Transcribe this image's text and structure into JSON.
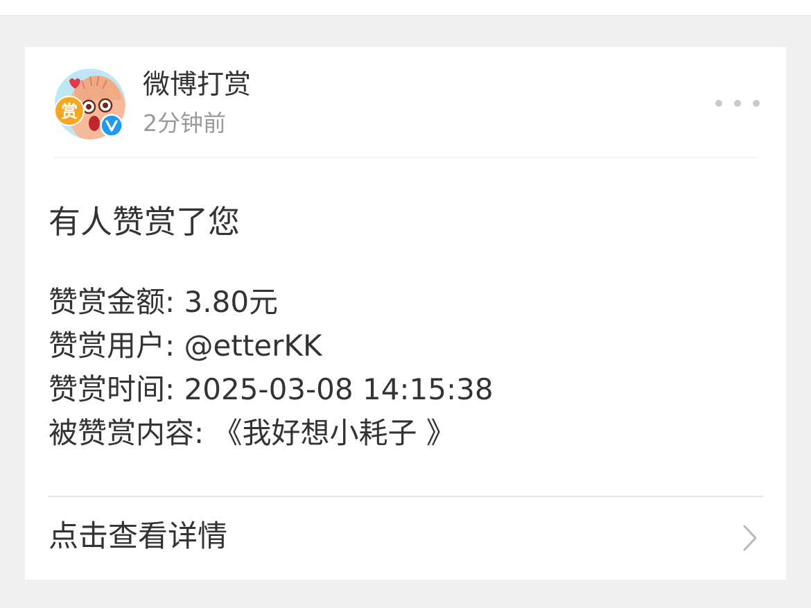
{
  "account": {
    "name": "微博打赏",
    "time": "2分钟前",
    "avatar_badge": "赏",
    "verified_badge": "V"
  },
  "message": {
    "title": "有人赞赏了您",
    "details": [
      {
        "label": "赞赏金额",
        "value": "3.80元"
      },
      {
        "label": "赞赏用户",
        "value": "@etterKK"
      },
      {
        "label": "赞赏时间",
        "value": "2025-03-08 14:15:38"
      },
      {
        "label": "被赞赏内容",
        "value": "《我好想小耗子 》"
      }
    ]
  },
  "footer": {
    "view_details_label": "点击查看详情"
  },
  "icons": {
    "more": "more-dots-icon",
    "chevron": "chevron-right-icon",
    "verified": "verified-icon"
  },
  "colors": {
    "background": "#efefef",
    "card": "#ffffff",
    "text_primary": "#333333",
    "text_secondary": "#9a9a9a",
    "verified_blue": "#1d9bf0",
    "badge_orange": "#f5a623"
  }
}
